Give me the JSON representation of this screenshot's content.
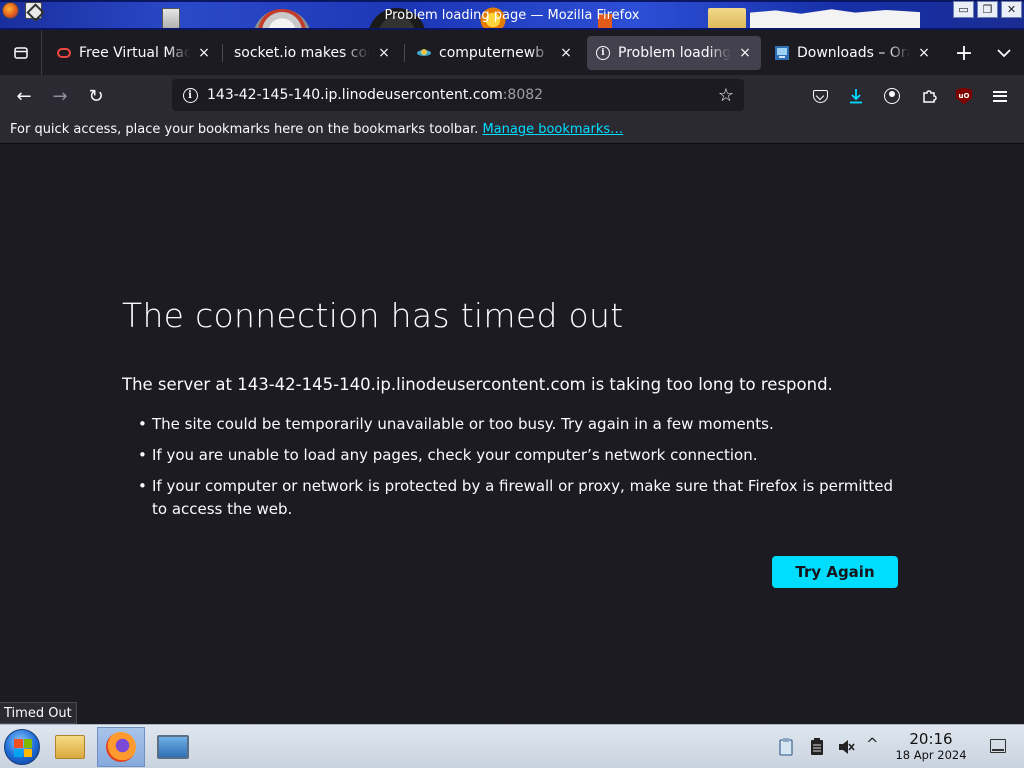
{
  "window": {
    "title": "Problem loading page — Mozilla Firefox",
    "controls": {
      "minimize": "▭",
      "restore": "❐",
      "close": "✕"
    }
  },
  "tabs": [
    {
      "label": "Free Virtual Machines",
      "favicon": "oracle-icon",
      "close": "×",
      "active": false
    },
    {
      "label": "socket.io makes comput",
      "favicon": "",
      "close": "×",
      "active": false
    },
    {
      "label": "computernewb",
      "favicon": "computernewb-icon",
      "close": "×",
      "active": false
    },
    {
      "label": "Problem loading page",
      "favicon": "info-icon",
      "close": "×",
      "active": true
    },
    {
      "label": "Downloads – Oracle",
      "favicon": "virtualbox-icon",
      "close": "×",
      "active": false
    }
  ],
  "tabstrip": {
    "new_tab": "+",
    "list_all": "⌄"
  },
  "nav": {
    "back": "←",
    "forward": "→",
    "reload": "↻",
    "url_host": "143-42-145-140.ip.linodeusercontent.com",
    "url_port": ":8082",
    "bookmark_star": "☆"
  },
  "bookmarks_bar": {
    "text": "For quick access, place your bookmarks here on the bookmarks toolbar.",
    "link": "Manage bookmarks…"
  },
  "error": {
    "title": "The connection has timed out",
    "description": "The server at 143-42-145-140.ip.linodeusercontent.com is taking too long to respond.",
    "bullets": [
      "The site could be temporarily unavailable or too busy. Try again in a few moments.",
      "If you are unable to load any pages, check your computer’s network connection.",
      "If your computer or network is protected by a firewall or proxy, make sure that Firefox is permitted to access the web."
    ],
    "button": "Try Again"
  },
  "status_tooltip": "Timed Out",
  "taskbar": {
    "time": "20:16",
    "date": "18 Apr 2024",
    "tray_chevron": "^",
    "ublock_label": "uO"
  },
  "colors": {
    "accent": "#00ddff",
    "page_bg": "#1c1b22",
    "toolbar_bg": "#2b2a33"
  }
}
